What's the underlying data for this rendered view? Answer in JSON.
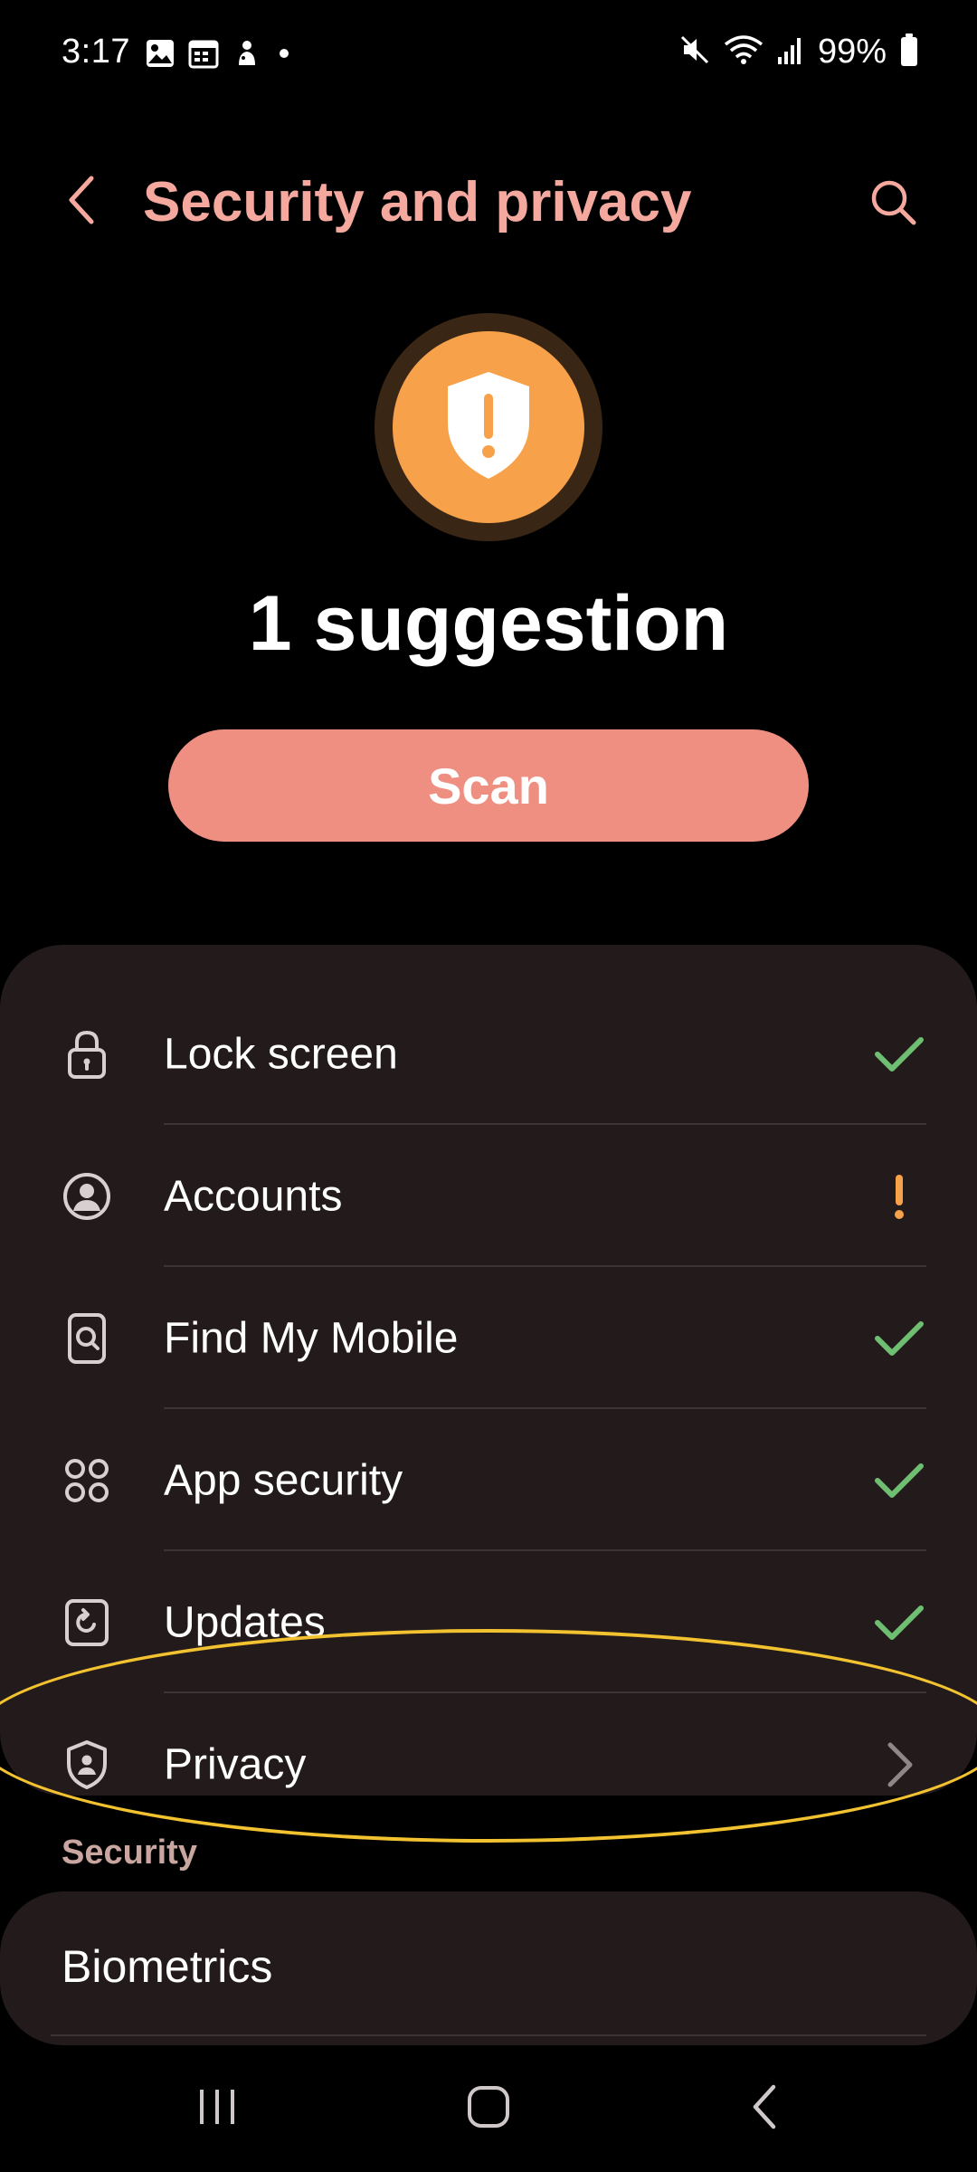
{
  "status_bar": {
    "time": "3:17",
    "battery_percent": "99%",
    "left_icons": [
      "gallery-icon",
      "calendar-icon",
      "notification-app-icon",
      "dot-icon"
    ],
    "right_icons": [
      "mute-icon",
      "wifi-icon",
      "signal-icon",
      "battery-icon"
    ]
  },
  "header": {
    "title": "Security and privacy",
    "title_color": "#f5a99e"
  },
  "hero": {
    "suggestion_text": "1 suggestion",
    "badge_color": "#f7a24a",
    "scan_label": "Scan",
    "scan_color": "#ef8f82"
  },
  "items": [
    {
      "label": "Lock screen",
      "icon": "lock-icon",
      "status": "ok"
    },
    {
      "label": "Accounts",
      "icon": "account-icon",
      "status": "warning"
    },
    {
      "label": "Find My Mobile",
      "icon": "find-my-mobile-icon",
      "status": "ok"
    },
    {
      "label": "App security",
      "icon": "app-security-icon",
      "status": "ok"
    },
    {
      "label": "Updates",
      "icon": "updates-icon",
      "status": "ok"
    },
    {
      "label": "Privacy",
      "icon": "privacy-shield-icon",
      "status": "chevron"
    }
  ],
  "status_colors": {
    "ok": "#6fbf73",
    "warning": "#f7a24a"
  },
  "sections": {
    "security_header": "Security",
    "biometrics_label": "Biometrics"
  },
  "highlight_color": "#f2c230"
}
